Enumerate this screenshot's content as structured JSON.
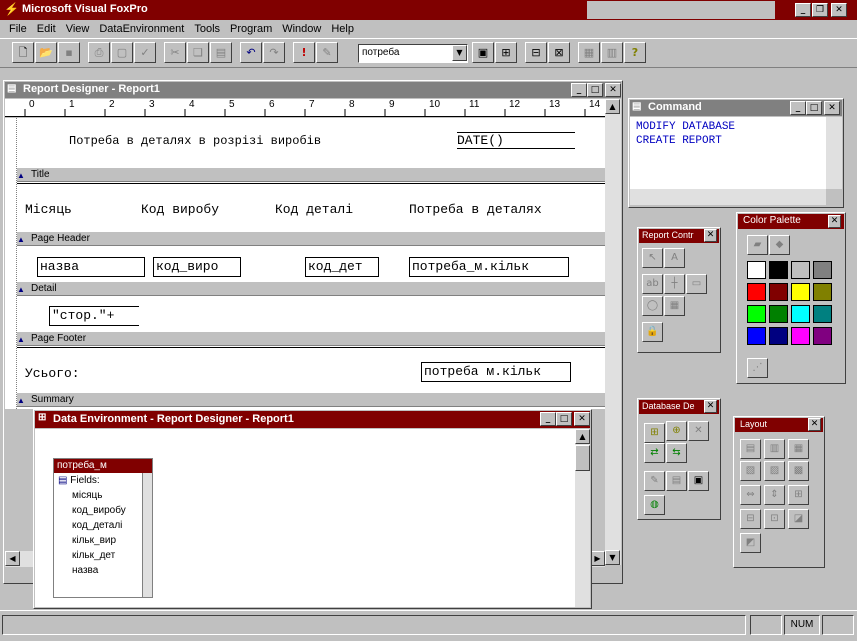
{
  "app": {
    "title": "Microsoft Visual FoxPro"
  },
  "menu": [
    "File",
    "Edit",
    "View",
    "DataEnvironment",
    "Tools",
    "Program",
    "Window",
    "Help"
  ],
  "toolbar": {
    "combo_value": "потреба",
    "run_label": "!",
    "help_label": "?"
  },
  "report": {
    "title": "Report Designer - Report1",
    "ruler": [
      "0",
      "1",
      "2",
      "3",
      "4",
      "5",
      "6",
      "7",
      "8",
      "9",
      "10",
      "11",
      "12",
      "13",
      "14"
    ],
    "title_band": {
      "label": "Title",
      "text": "Потреба в деталях в розрізі виробів",
      "date": "DATE()"
    },
    "header_band": {
      "label": "Page Header",
      "cols": [
        "Місяць",
        "Код виробу",
        "Код деталі",
        "Потреба в деталях"
      ]
    },
    "detail_band": {
      "label": "Detail",
      "fields": [
        "назва",
        "код_виро",
        "код_дет",
        "потреба_м.кільк"
      ]
    },
    "footer_band": {
      "label": "Page Footer",
      "expr": "\"стор.\"+"
    },
    "summary_band": {
      "label": "Summary",
      "text": "Усього:",
      "field": "потреба м.кільк"
    }
  },
  "dataenv": {
    "title": "Data Environment - Report Designer - Report1",
    "table": "потреба_м",
    "fields": [
      "Fields:",
      "місяць",
      "код_виробу",
      "код_деталі",
      "кільк_вир",
      "кільк_дет",
      "назва"
    ]
  },
  "command": {
    "title": "Command",
    "lines": [
      "MODIFY DATABASE",
      "CREATE REPORT"
    ]
  },
  "report_controls": {
    "title": "Report Contr"
  },
  "color_palette": {
    "title": "Color Palette",
    "colors": [
      "#ffffff",
      "#000000",
      "#c0c0c0",
      "#808080",
      "#ff0000",
      "#800000",
      "#ffff00",
      "#808000",
      "#00ff00",
      "#008000",
      "#00ffff",
      "#008080",
      "#0000ff",
      "#000080",
      "#ff00ff",
      "#800080"
    ]
  },
  "database_designer": {
    "title": "Database De"
  },
  "layout": {
    "title": "Layout"
  },
  "status": {
    "num": "NUM"
  }
}
